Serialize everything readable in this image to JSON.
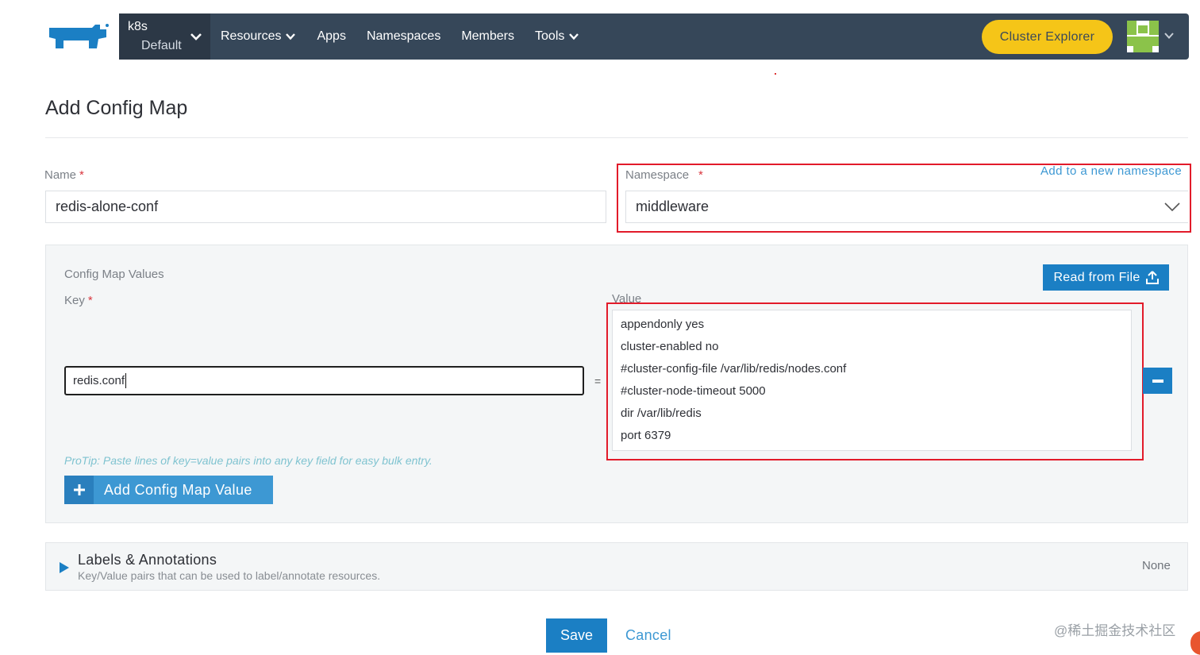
{
  "nav": {
    "cluster_name": "k8s",
    "project_name": "Default",
    "links": [
      {
        "label": "Resources",
        "has_dropdown": true
      },
      {
        "label": "Apps",
        "has_dropdown": false
      },
      {
        "label": "Namespaces",
        "has_dropdown": false
      },
      {
        "label": "Members",
        "has_dropdown": false
      },
      {
        "label": "Tools",
        "has_dropdown": true
      }
    ],
    "cluster_explorer_label": "Cluster Explorer",
    "logo_icon": "rancher-cow-icon",
    "avatar_icon": "user-avatar-icon"
  },
  "page": {
    "title": "Add Config Map"
  },
  "form": {
    "name_label": "Name",
    "name_value": "redis-alone-conf",
    "namespace_label": "Namespace",
    "namespace_value": "middleware",
    "add_namespace_link": "Add to a new namespace",
    "required_mark": "*"
  },
  "config_values": {
    "section_label": "Config Map Values",
    "key_label": "Key",
    "value_label": "Value",
    "read_from_file_label": "Read from File",
    "key_value": "redis.conf",
    "equals": "=",
    "value_lines": [
      "appendonly yes",
      "cluster-enabled no",
      "#cluster-config-file /var/lib/redis/nodes.conf",
      "#cluster-node-timeout 5000",
      "dir /var/lib/redis",
      "port 6379"
    ],
    "protip": "ProTip: Paste lines of key=value pairs into any key field for easy bulk entry.",
    "add_value_label": "Add Config Map Value"
  },
  "labels_section": {
    "title": "Labels & Annotations",
    "description": "Key/Value pairs that can be used to label/annotate resources.",
    "status": "None"
  },
  "footer": {
    "save_label": "Save",
    "cancel_label": "Cancel",
    "watermark": "@稀土掘金技术社区"
  },
  "colors": {
    "nav_bg": "#364759",
    "accent_blue": "#1b7fc4",
    "explorer_yellow": "#f5c518",
    "highlight_red": "#e21b2a"
  }
}
